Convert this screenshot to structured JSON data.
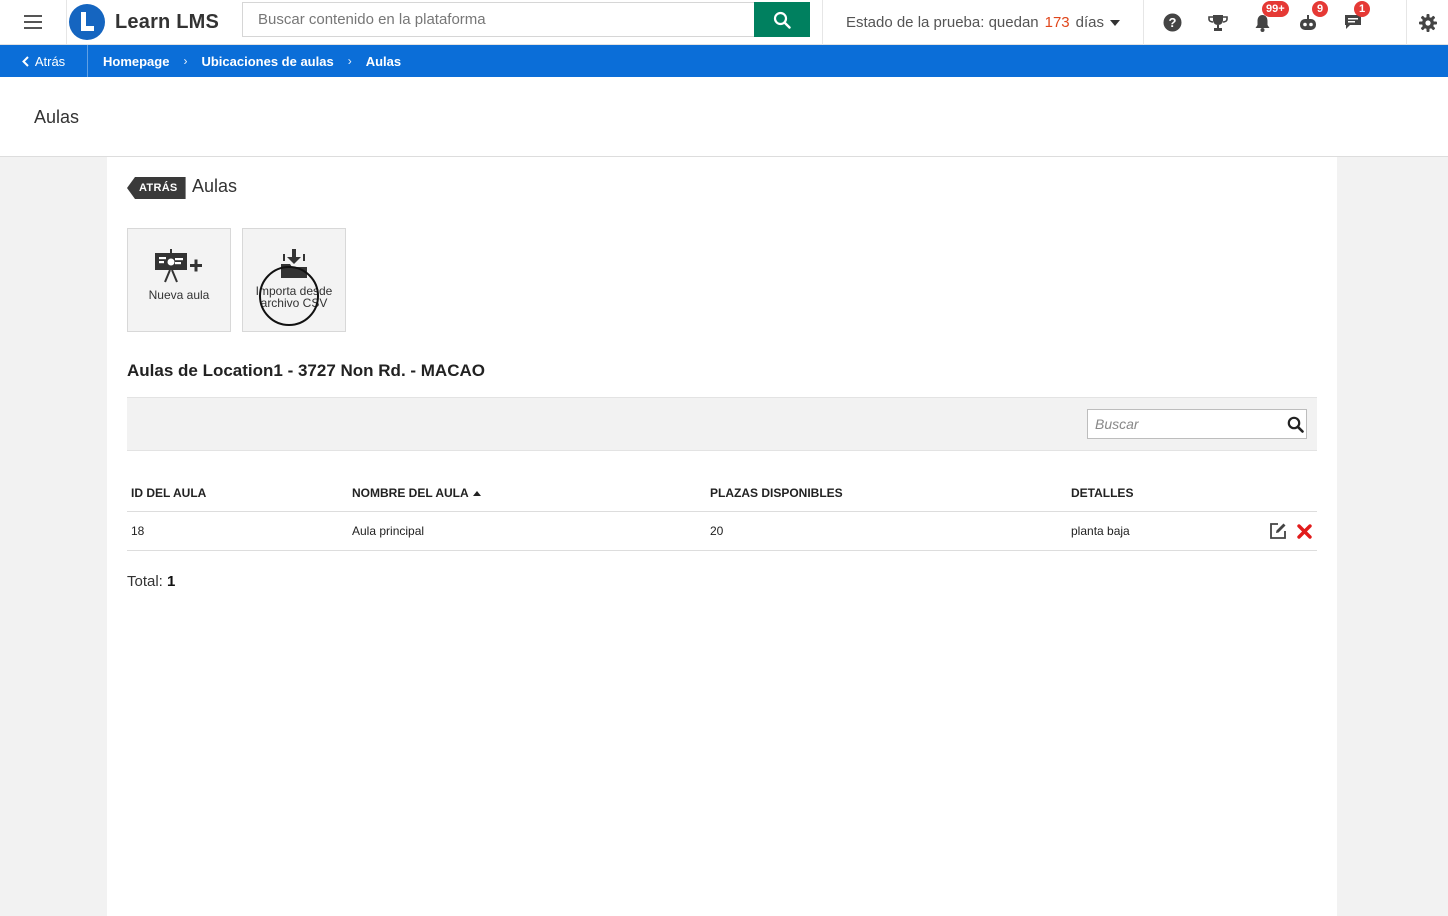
{
  "header": {
    "brand": "Learn LMS",
    "search_placeholder": "Buscar contenido en la plataforma",
    "trial_prefix": "Estado de la prueba: quedan",
    "trial_days": "173",
    "trial_suffix": "días",
    "badges": {
      "notifications": "99+",
      "bot": "9",
      "messages": "1"
    }
  },
  "breadcrumb": {
    "back_label": "Atrás",
    "items": [
      "Homepage",
      "Ubicaciones de aulas",
      "Aulas"
    ]
  },
  "page": {
    "title": "Aulas"
  },
  "card": {
    "back_tag": "ATRÁS",
    "title": "Aulas",
    "tiles": {
      "new_label": "Nueva aula",
      "import_label": "Importa desde archivo CSV"
    },
    "list_title": "Aulas de Location1 - 3727 Non Rd. - MACAO",
    "search_placeholder": "Buscar",
    "table": {
      "columns": [
        "ID DEL AULA",
        "NOMBRE DEL AULA",
        "PLAZAS DISPONIBLES",
        "DETALLES"
      ],
      "rows": [
        {
          "id": "18",
          "name": "Aula principal",
          "seats": "20",
          "details": "planta baja"
        }
      ]
    },
    "total_label": "Total:",
    "total_value": "1"
  },
  "colors": {
    "brand_blue": "#1565c0",
    "breadcrumb_bar": "#0b6ed8",
    "search_button": "#00805f",
    "trial_days": "#e0461b",
    "badge": "#e53935",
    "delete": "#e11b1b"
  }
}
